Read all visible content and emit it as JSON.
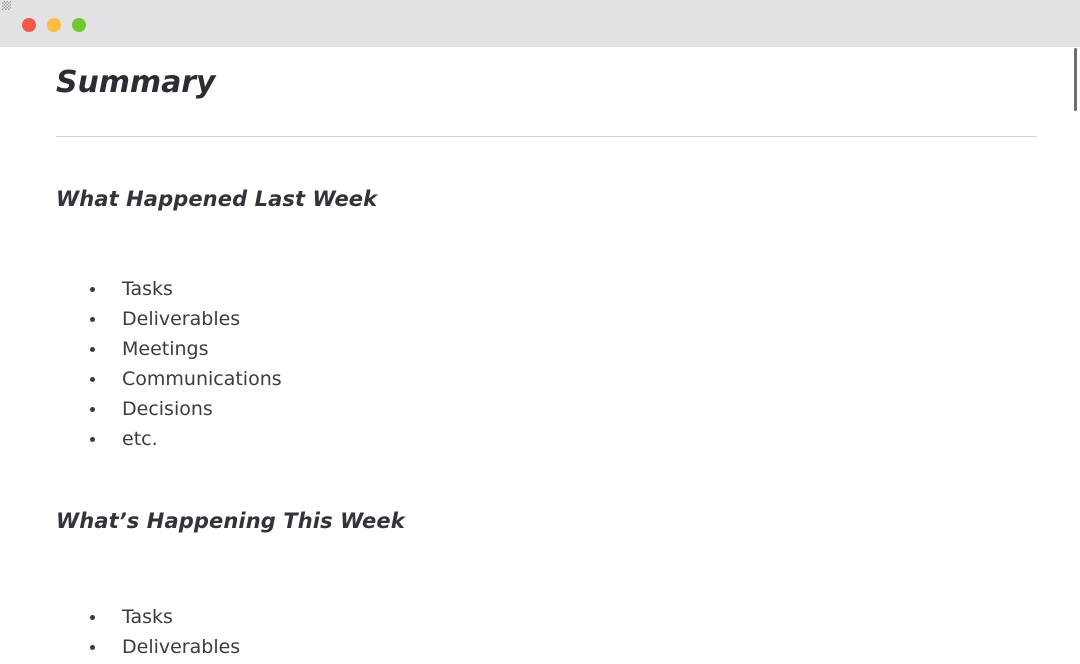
{
  "window": {
    "controls": [
      {
        "name": "close",
        "color": "#f8574d"
      },
      {
        "name": "minimize",
        "color": "#fcbd41"
      },
      {
        "name": "maximize",
        "color": "#6fc92e"
      }
    ]
  },
  "document": {
    "title": "Summary",
    "sections": [
      {
        "heading": "What Happened Last Week",
        "items": [
          "Tasks",
          "Deliverables",
          "Meetings",
          "Communications",
          "Decisions",
          "etc."
        ]
      },
      {
        "heading": "What’s Happening This Week",
        "items": [
          "Tasks",
          "Deliverables"
        ]
      }
    ]
  },
  "scrollbar": {
    "orientation": "vertical",
    "position": "top"
  }
}
